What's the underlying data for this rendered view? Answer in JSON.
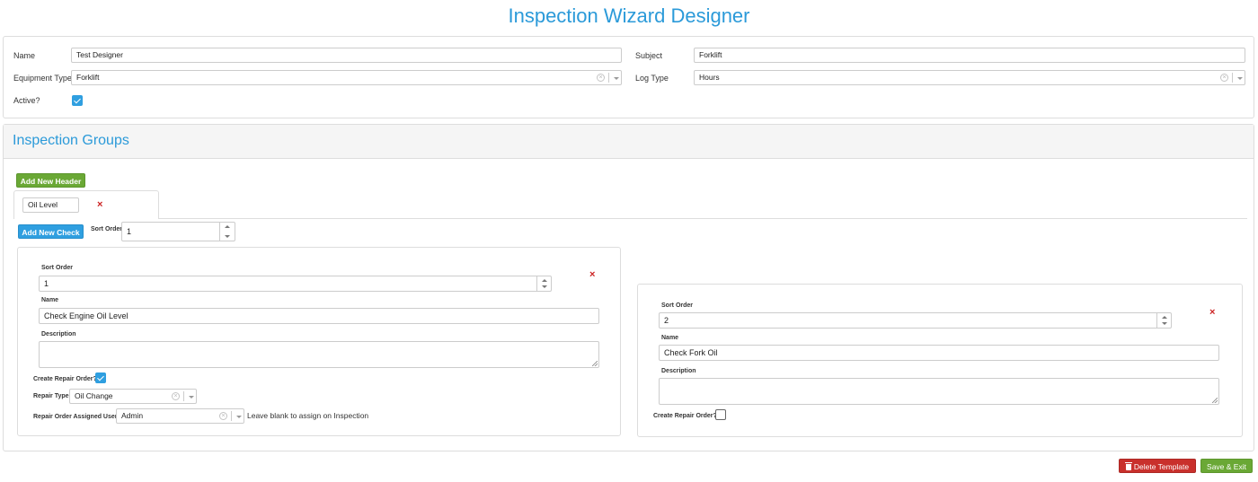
{
  "page": {
    "title": "Inspection Wizard Designer"
  },
  "template_form": {
    "name_label": "Name",
    "name_value": "Test Designer",
    "subject_label": "Subject",
    "subject_value": "Forklift",
    "equipment_type_label": "Equipment Type",
    "equipment_type_value": "Forklift",
    "log_type_label": "Log Type",
    "log_type_value": "Hours",
    "active_label": "Active?",
    "active_checked": true
  },
  "groups": {
    "heading": "Inspection Groups",
    "add_header_label": "Add New Header",
    "tab_name_value": "Oil Level",
    "add_check_label": "Add New Check",
    "sort_order_label": "Sort Order",
    "sort_order_value": "1"
  },
  "checks": [
    {
      "sort_order_label": "Sort Order",
      "sort_order_value": "1",
      "name_label": "Name",
      "name_value": "Check Engine Oil Level",
      "description_label": "Description",
      "description_value": "",
      "create_repair_label": "Create Repair Order?",
      "create_repair_checked": true,
      "repair_type_label": "Repair Type",
      "repair_type_value": "Oil Change",
      "assigned_user_label": "Repair Order Assigned User",
      "assigned_user_value": "Admin",
      "assigned_user_hint": "Leave blank to assign on Inspection"
    },
    {
      "sort_order_label": "Sort Order",
      "sort_order_value": "2",
      "name_label": "Name",
      "name_value": "Check Fork Oil",
      "description_label": "Description",
      "description_value": "",
      "create_repair_label": "Create Repair Order?",
      "create_repair_checked": false
    }
  ],
  "footer": {
    "delete_label": "Delete Template",
    "save_label": "Save & Exit"
  },
  "icons": {
    "remove": "close-x",
    "clear": "circle-x",
    "dropdown": "caret-down",
    "delete": "trash"
  },
  "colors": {
    "accent": "#2b9ad9",
    "green": "#6aa835",
    "red": "#c9302c",
    "remove_x": "#cc2222"
  }
}
